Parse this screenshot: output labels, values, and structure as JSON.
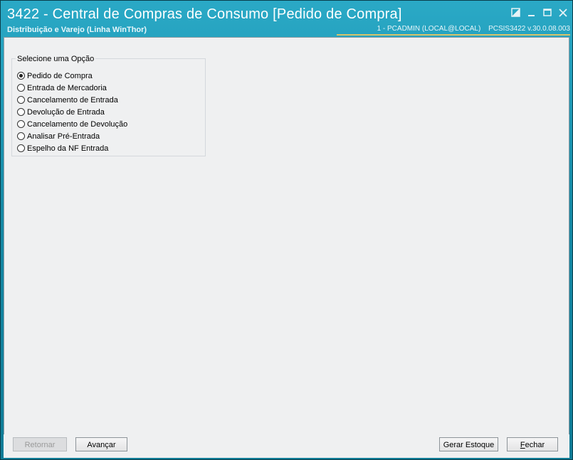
{
  "window": {
    "title": "3422 - Central de Compras de Consumo [Pedido de Compra]",
    "subtitle": "Distribuição e Varejo (Linha WinThor)",
    "status_user": "1 - PCADMIN (LOCAL@LOCAL)",
    "status_version": "PCSIS3422  v.30.0.08.003",
    "colors": {
      "titlebar": "#168aa6",
      "client_bg": "#eff0f1",
      "accent_line": "#d8c36a"
    }
  },
  "controls": {
    "restore_icon": "restore-icon",
    "minimize_icon": "minimize-icon",
    "maximize_icon": "maximize-icon",
    "close_icon": "close-icon"
  },
  "options_group": {
    "legend": "Selecione uma Opção",
    "selected_index": 0,
    "items": [
      {
        "label": "Pedido de Compra",
        "checked": true
      },
      {
        "label": "Entrada de Mercadoria",
        "checked": false
      },
      {
        "label": "Cancelamento de Entrada",
        "checked": false
      },
      {
        "label": "Devolução de Entrada",
        "checked": false
      },
      {
        "label": "Cancelamento de Devolução",
        "checked": false
      },
      {
        "label": "Analisar Pré-Entrada",
        "checked": false
      },
      {
        "label": "Espelho da NF Entrada",
        "checked": false
      }
    ]
  },
  "footer": {
    "retornar_label": "Retornar",
    "avancar_label": "Avançar",
    "gerar_estoque_label": "Gerar Estoque",
    "fechar_label": "Fechar"
  }
}
